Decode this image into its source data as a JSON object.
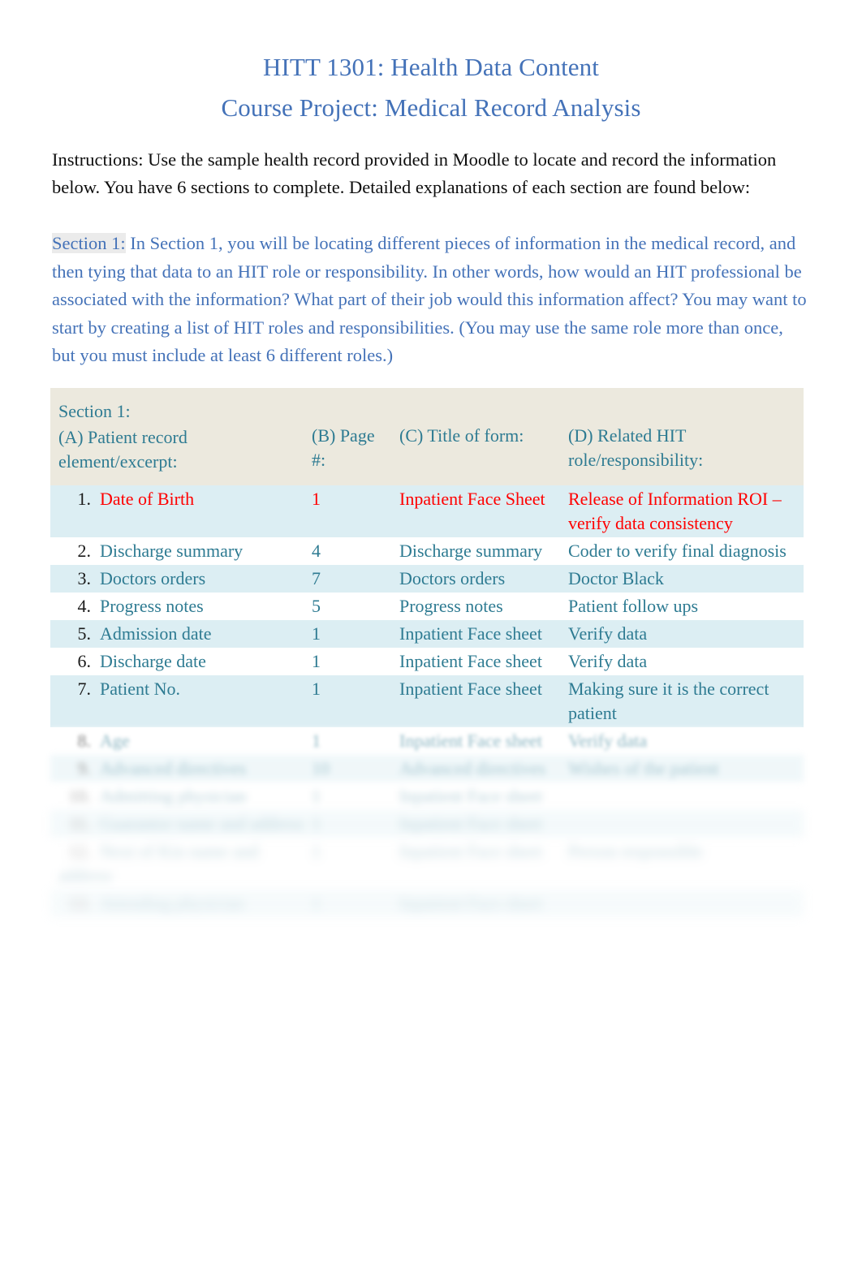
{
  "document": {
    "title_line1": "HITT 1301: Health Data Content",
    "title_line2": "Course Project: Medical Record Analysis",
    "title_color": "#4472b8",
    "instructions": "Instructions:   Use the sample health record provided in Moodle to locate and record the information below.    You have 6 sections to complete.    Detailed explanations of each section are found below:",
    "section_intro_label": "Section 1:",
    "section_intro_body": "  In Section 1, you will be locating different pieces of information in the medical record, and then tying that data to an HIT role or responsibility.      In other words, how would an HIT professional be associated with the information?    What part of their job would this information affect?   You may want to start by creating a list of HIT roles and responsibilities. (You may use the same role more than once, but you must include at least 6 different roles.)"
  },
  "colors": {
    "accent_blue": "#4472b8",
    "teal_text": "#2e7b92",
    "red_text": "#ff0000",
    "header_bg": "#ece9de",
    "row_stripe_bg": "#dceef3",
    "page_bg": "#ffffff"
  },
  "table": {
    "caption": "Section 1:",
    "headers": {
      "a": "(A) Patient record element/excerpt:",
      "b": "(B) Page #:",
      "c": "(C) Title of form:",
      "d": "(D) Related HIT role/responsibility:"
    },
    "rows": [
      {
        "num": "1.",
        "a": "Date of Birth",
        "b": "1",
        "c": "Inpatient Face Sheet",
        "d": "Release of Information ROI – verify data consistency",
        "style": "red",
        "stripe": true,
        "blur": 0
      },
      {
        "num": "2.",
        "a": "Discharge summary",
        "b": "4",
        "c": "Discharge summary",
        "d": "Coder to verify final diagnosis",
        "style": "normal",
        "stripe": false,
        "blur": 0
      },
      {
        "num": "3.",
        "a": "Doctors orders",
        "b": "7",
        "c": "Doctors orders",
        "d": "Doctor Black",
        "style": "normal",
        "stripe": true,
        "blur": 0
      },
      {
        "num": "4.",
        "a": "Progress notes",
        "b": "5",
        "c": "Progress notes",
        "d": "Patient follow ups",
        "style": "normal",
        "stripe": false,
        "blur": 0
      },
      {
        "num": "5.",
        "a": "Admission date",
        "b": "1",
        "c": "Inpatient Face sheet",
        "d": "Verify data",
        "style": "normal",
        "stripe": true,
        "blur": 0
      },
      {
        "num": "6.",
        "a": "Discharge date",
        "b": "1",
        "c": "Inpatient Face sheet",
        "d": "Verify data",
        "style": "normal",
        "stripe": false,
        "blur": 0
      },
      {
        "num": "7.",
        "a": "Patient No.",
        "b": "1",
        "c": "Inpatient Face sheet",
        "d": "Making sure it is the correct patient",
        "style": "normal",
        "stripe": true,
        "blur": 0
      },
      {
        "num": "8.",
        "a": "Age",
        "b": "1",
        "c": "Inpatient Face sheet",
        "d": "Verify data",
        "style": "normal",
        "stripe": false,
        "blur": 1
      },
      {
        "num": "9.",
        "a": "Advanced directives",
        "b": "10",
        "c": "Advanced directives",
        "d": "Wishes of the patient",
        "style": "normal",
        "stripe": true,
        "blur": 2
      },
      {
        "num": "10.",
        "a": "Admitting physician",
        "b": "1",
        "c": "Inpatient Face sheet",
        "d": "",
        "style": "normal",
        "stripe": false,
        "blur": 3
      },
      {
        "num": "11.",
        "a": "Guarantor name and address",
        "b": "1",
        "c": "Inpatient Face sheet",
        "d": "",
        "style": "normal",
        "stripe": true,
        "blur": 4
      },
      {
        "num": "12.",
        "a": "Next of Kin name and address",
        "b": "1",
        "c": "Inpatient Face sheet",
        "d": "Person responsible",
        "style": "normal",
        "stripe": false,
        "blur": 5
      },
      {
        "num": "13.",
        "a": "Attending physician",
        "b": "1",
        "c": "Inpatient Face sheet",
        "d": "",
        "style": "normal",
        "stripe": true,
        "blur": 6
      }
    ]
  }
}
